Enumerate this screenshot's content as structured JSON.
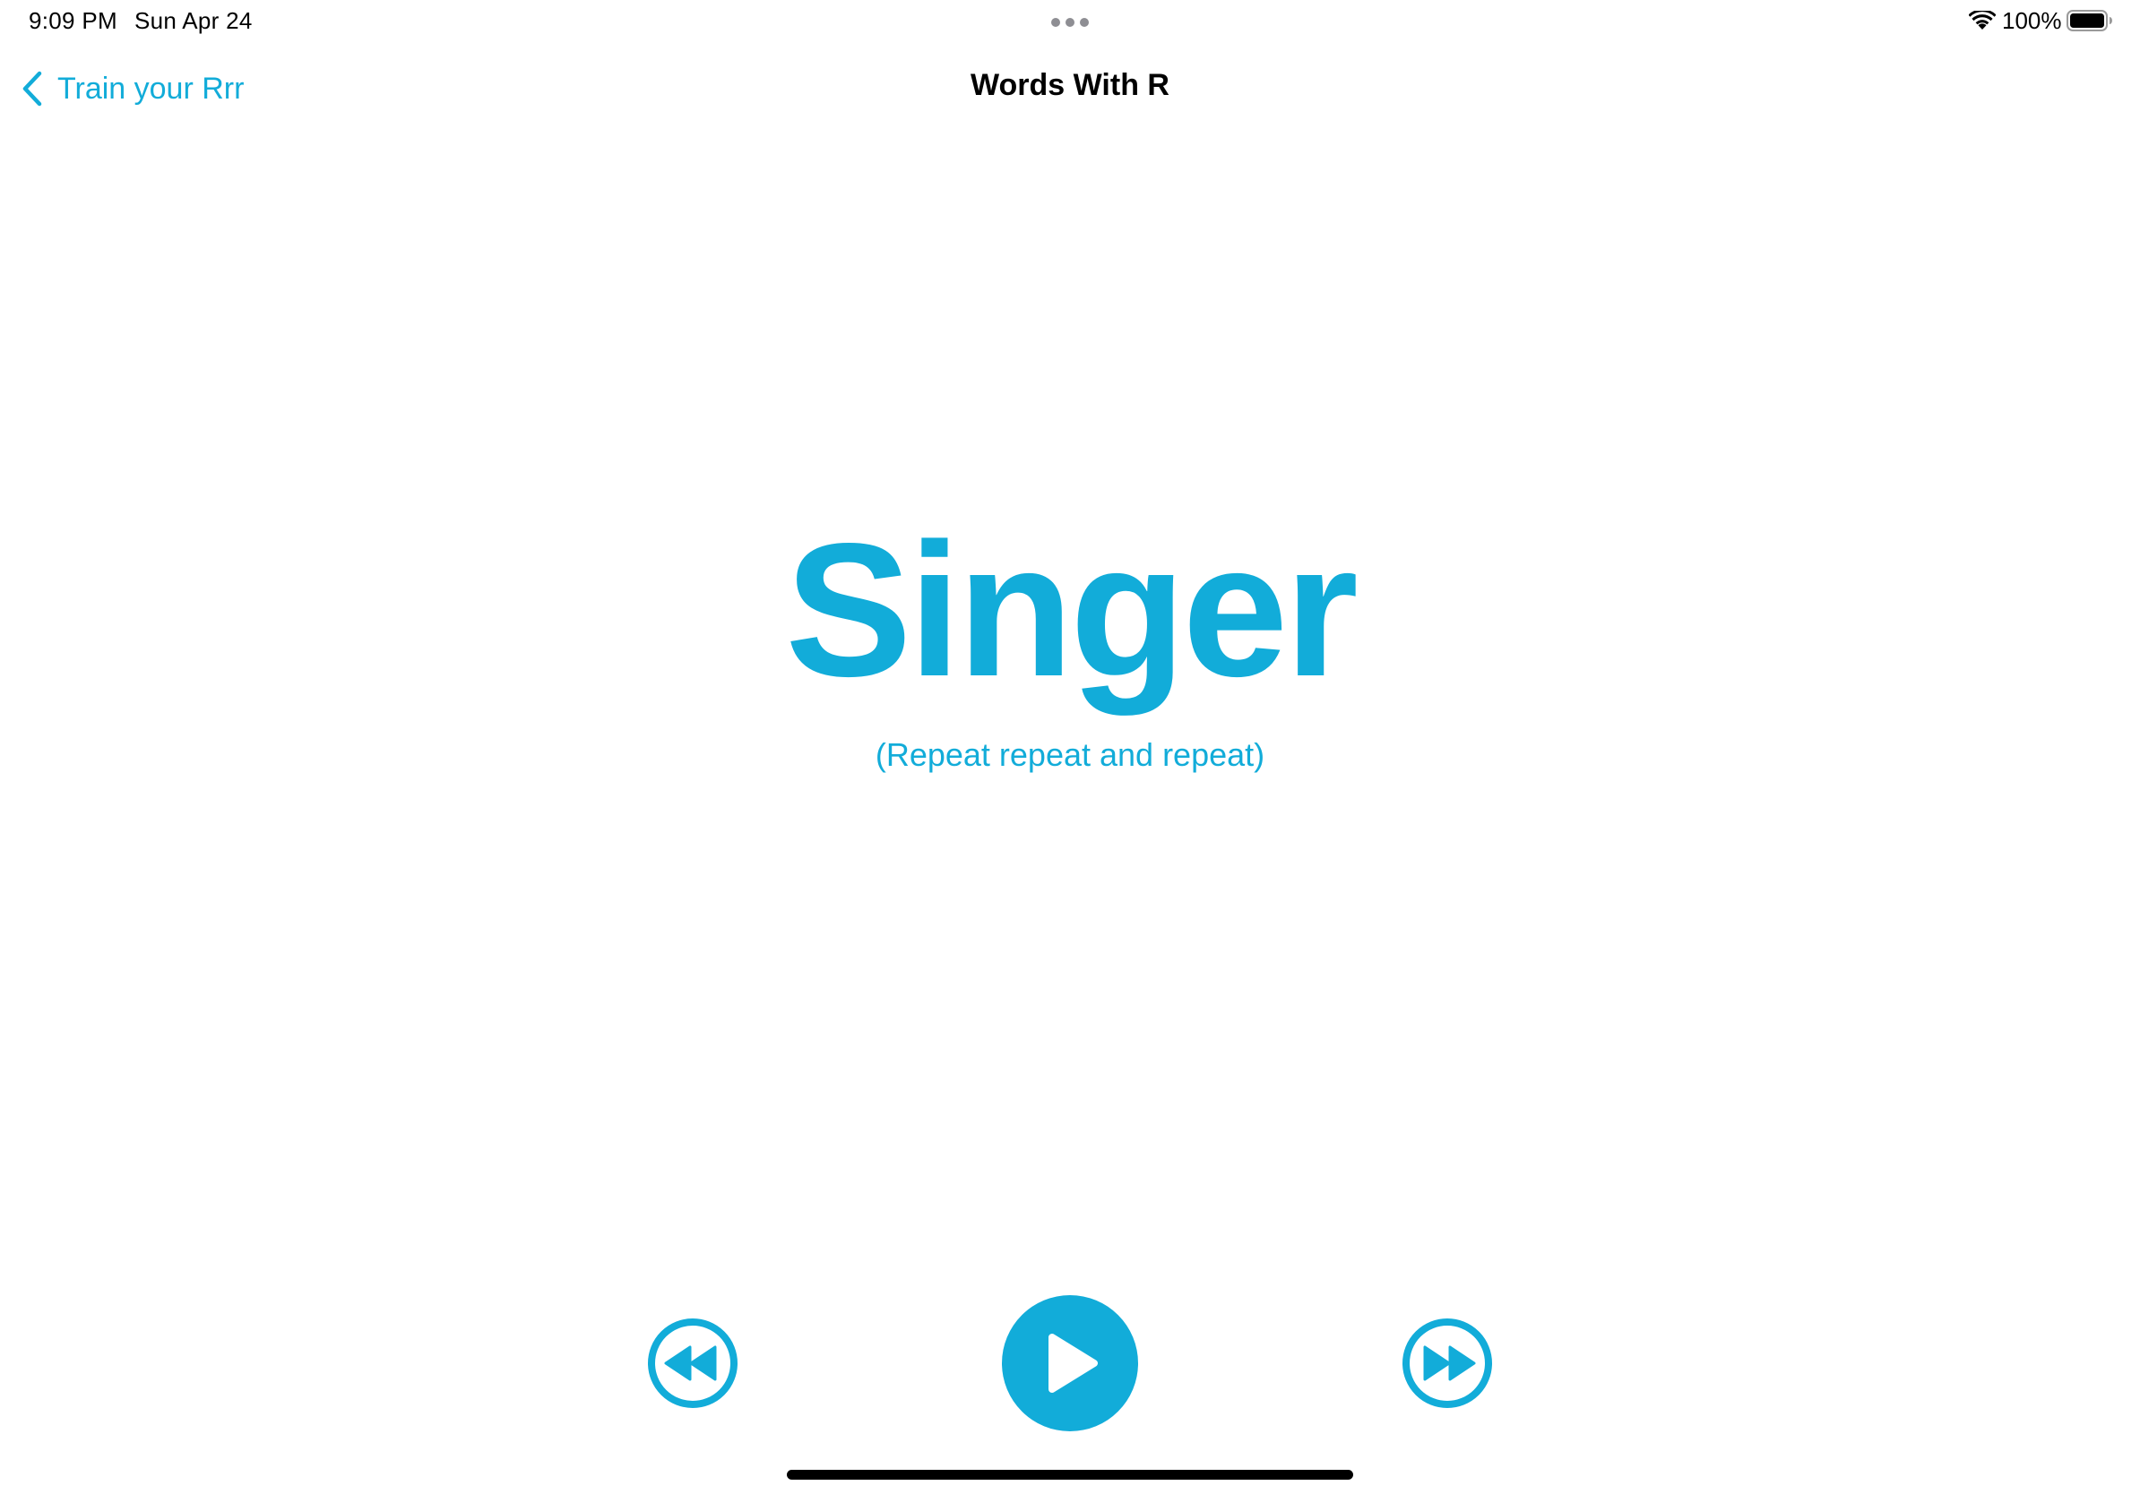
{
  "status_bar": {
    "time": "9:09 PM",
    "date": "Sun Apr 24",
    "battery_percent": "100%",
    "battery_level": 1.0,
    "icons": [
      "multitasking-dots-icon",
      "wifi-icon",
      "battery-icon"
    ]
  },
  "nav": {
    "back_label": "Train your Rrr",
    "title": "Words With R"
  },
  "content": {
    "word": "Singer",
    "hint": "(Repeat repeat and repeat)"
  },
  "controls": {
    "rewind_icon": "rewind-icon",
    "play_icon": "play-icon",
    "forward_icon": "fast-forward-icon"
  },
  "colors": {
    "accent": "#12ACD9",
    "text": "#000000",
    "background": "#FFFFFF"
  }
}
